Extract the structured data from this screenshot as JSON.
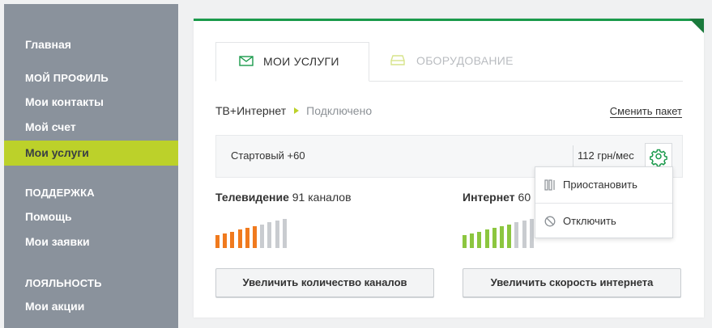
{
  "sidebar": {
    "items": [
      {
        "label": "Главная"
      },
      {
        "label": "МОЙ ПРОФИЛЬ"
      },
      {
        "label": "Мои контакты"
      },
      {
        "label": "Мой счет"
      },
      {
        "label": "Мои услуги"
      },
      {
        "label": "ПОДДЕРЖКА"
      },
      {
        "label": "Помощь"
      },
      {
        "label": "Мои заявки"
      },
      {
        "label": "ЛОЯЛЬНОСТЬ"
      },
      {
        "label": "Мои акции"
      }
    ],
    "active": "Мои услуги"
  },
  "tabs": [
    {
      "label": "МОИ УСЛУГИ",
      "icon": "envelope-icon"
    },
    {
      "label": "ОБОРУДОВАНИЕ",
      "icon": "router-icon"
    }
  ],
  "service": {
    "name": "ТВ+Интернет",
    "status": "Подключено",
    "change_link": "Сменить пакет"
  },
  "plan": {
    "name": "Стартовый +60",
    "price": "112 грн/мес",
    "settings_icon": "gear-icon"
  },
  "tv": {
    "title": "Телевидение",
    "detail": "91 каналов",
    "button": "Увеличить количество каналов",
    "level": 0.6
  },
  "internet": {
    "title": "Интернет",
    "detail": "60",
    "button": "Увеличить скорость интернета",
    "level": 0.7
  },
  "menu": {
    "items": [
      {
        "label": "Приостановить",
        "icon": "pause-icon"
      },
      {
        "label": "Отключить",
        "icon": "disable-icon"
      }
    ]
  },
  "colors": {
    "accent_green": "#1a9a4b",
    "sidebar_bg": "#8a929c",
    "active_item": "#bcd12a",
    "tv_bar": "#f07a1e",
    "internet_bar": "#8cc63f",
    "inactive_bar": "#c9ccd0"
  }
}
